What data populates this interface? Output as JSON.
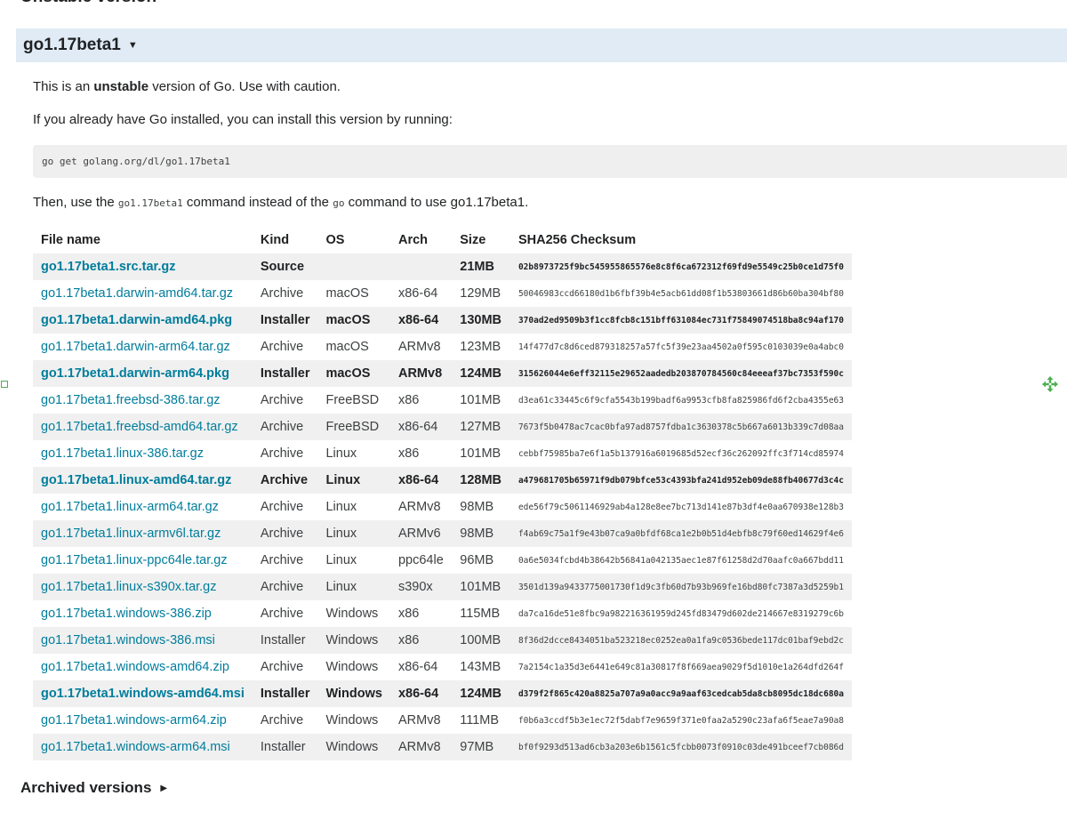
{
  "section": {
    "heading": "Unstable version",
    "toggle_title": "go1.17beta1",
    "toggle_caret": "▼"
  },
  "intro": {
    "line1_prefix": "This is an ",
    "line1_bold": "unstable",
    "line1_suffix": " version of Go. Use with caution.",
    "line2": "If you already have Go installed, you can install this version by running:",
    "command": "go get golang.org/dl/go1.17beta1",
    "line3_prefix": "Then, use the ",
    "line3_code1": "go1.17beta1",
    "line3_mid": " command instead of the ",
    "line3_code2": "go",
    "line3_suffix": " command to use go1.17beta1."
  },
  "table": {
    "headers": [
      "File name",
      "Kind",
      "OS",
      "Arch",
      "Size",
      "SHA256 Checksum"
    ],
    "rows": [
      {
        "file": "go1.17beta1.src.tar.gz",
        "kind": "Source",
        "os": "",
        "arch": "",
        "size": "21MB",
        "sum": "02b8973725f9bc545955865576e8c8f6ca672312f69fd9e5549c25b0ce1d75f0",
        "highlight": true
      },
      {
        "file": "go1.17beta1.darwin-amd64.tar.gz",
        "kind": "Archive",
        "os": "macOS",
        "arch": "x86-64",
        "size": "129MB",
        "sum": "50046983ccd66180d1b6fbf39b4e5acb61dd08f1b53803661d86b60ba304bf80",
        "highlight": false
      },
      {
        "file": "go1.17beta1.darwin-amd64.pkg",
        "kind": "Installer",
        "os": "macOS",
        "arch": "x86-64",
        "size": "130MB",
        "sum": "370ad2ed9509b3f1cc8fcb8c151bff631084ec731f75849074518ba8c94af170",
        "highlight": true
      },
      {
        "file": "go1.17beta1.darwin-arm64.tar.gz",
        "kind": "Archive",
        "os": "macOS",
        "arch": "ARMv8",
        "size": "123MB",
        "sum": "14f477d7c8d6ced879318257a57fc5f39e23aa4502a0f595c0103039e0a4abc0",
        "highlight": false
      },
      {
        "file": "go1.17beta1.darwin-arm64.pkg",
        "kind": "Installer",
        "os": "macOS",
        "arch": "ARMv8",
        "size": "124MB",
        "sum": "315626044e6eff32115e29652aadedb203870784560c84eeeaf37bc7353f590c",
        "highlight": true
      },
      {
        "file": "go1.17beta1.freebsd-386.tar.gz",
        "kind": "Archive",
        "os": "FreeBSD",
        "arch": "x86",
        "size": "101MB",
        "sum": "d3ea61c33445c6f9cfa5543b199badf6a9953cfb8fa825986fd6f2cba4355e63",
        "highlight": false
      },
      {
        "file": "go1.17beta1.freebsd-amd64.tar.gz",
        "kind": "Archive",
        "os": "FreeBSD",
        "arch": "x86-64",
        "size": "127MB",
        "sum": "7673f5b0478ac7cac0bfa97ad8757fdba1c3630378c5b667a6013b339c7d08aa",
        "highlight": false
      },
      {
        "file": "go1.17beta1.linux-386.tar.gz",
        "kind": "Archive",
        "os": "Linux",
        "arch": "x86",
        "size": "101MB",
        "sum": "cebbf75985ba7e6f1a5b137916a6019685d52ecf36c262092ffc3f714cd85974",
        "highlight": false
      },
      {
        "file": "go1.17beta1.linux-amd64.tar.gz",
        "kind": "Archive",
        "os": "Linux",
        "arch": "x86-64",
        "size": "128MB",
        "sum": "a479681705b65971f9db079bfce53c4393bfa241d952eb09de88fb40677d3c4c",
        "highlight": true
      },
      {
        "file": "go1.17beta1.linux-arm64.tar.gz",
        "kind": "Archive",
        "os": "Linux",
        "arch": "ARMv8",
        "size": "98MB",
        "sum": "ede56f79c5061146929ab4a128e8ee7bc713d141e87b3df4e0aa670938e128b3",
        "highlight": false
      },
      {
        "file": "go1.17beta1.linux-armv6l.tar.gz",
        "kind": "Archive",
        "os": "Linux",
        "arch": "ARMv6",
        "size": "98MB",
        "sum": "f4ab69c75a1f9e43b07ca9a0bfdf68ca1e2b0b51d4ebfb8c79f60ed14629f4e6",
        "highlight": false
      },
      {
        "file": "go1.17beta1.linux-ppc64le.tar.gz",
        "kind": "Archive",
        "os": "Linux",
        "arch": "ppc64le",
        "size": "96MB",
        "sum": "0a6e5034fcbd4b38642b56841a042135aec1e87f61258d2d70aafc0a667bdd11",
        "highlight": false
      },
      {
        "file": "go1.17beta1.linux-s390x.tar.gz",
        "kind": "Archive",
        "os": "Linux",
        "arch": "s390x",
        "size": "101MB",
        "sum": "3501d139a9433775001730f1d9c3fb60d7b93b969fe16bd80fc7387a3d5259b1",
        "highlight": false
      },
      {
        "file": "go1.17beta1.windows-386.zip",
        "kind": "Archive",
        "os": "Windows",
        "arch": "x86",
        "size": "115MB",
        "sum": "da7ca16de51e8fbc9a982216361959d245fd83479d602de214667e8319279c6b",
        "highlight": false
      },
      {
        "file": "go1.17beta1.windows-386.msi",
        "kind": "Installer",
        "os": "Windows",
        "arch": "x86",
        "size": "100MB",
        "sum": "8f36d2dcce8434051ba523218ec0252ea0a1fa9c0536bede117dc01baf9ebd2c",
        "highlight": false
      },
      {
        "file": "go1.17beta1.windows-amd64.zip",
        "kind": "Archive",
        "os": "Windows",
        "arch": "x86-64",
        "size": "143MB",
        "sum": "7a2154c1a35d3e6441e649c81a30817f8f669aea9029f5d1010e1a264dfd264f",
        "highlight": false
      },
      {
        "file": "go1.17beta1.windows-amd64.msi",
        "kind": "Installer",
        "os": "Windows",
        "arch": "x86-64",
        "size": "124MB",
        "sum": "d379f2f865c420a8825a707a9a0acc9a9aaf63cedcab5da8cb8095dc18dc680a",
        "highlight": true
      },
      {
        "file": "go1.17beta1.windows-arm64.zip",
        "kind": "Archive",
        "os": "Windows",
        "arch": "ARMv8",
        "size": "111MB",
        "sum": "f0b6a3ccdf5b3e1ec72f5dabf7e9659f371e0faa2a5290c23afa6f5eae7a90a8",
        "highlight": false
      },
      {
        "file": "go1.17beta1.windows-arm64.msi",
        "kind": "Installer",
        "os": "Windows",
        "arch": "ARMv8",
        "size": "97MB",
        "sum": "bf0f9293d513ad6cb3a203e6b1561c5fcbb0073f0910c03de491bceef7cb086d",
        "highlight": false
      }
    ]
  },
  "archived": {
    "heading": "Archived versions",
    "caret": "▶"
  },
  "icons": {
    "move": "move-cursor-icon",
    "marker": "selection-handle-icon",
    "move_color": "#4caf50"
  }
}
